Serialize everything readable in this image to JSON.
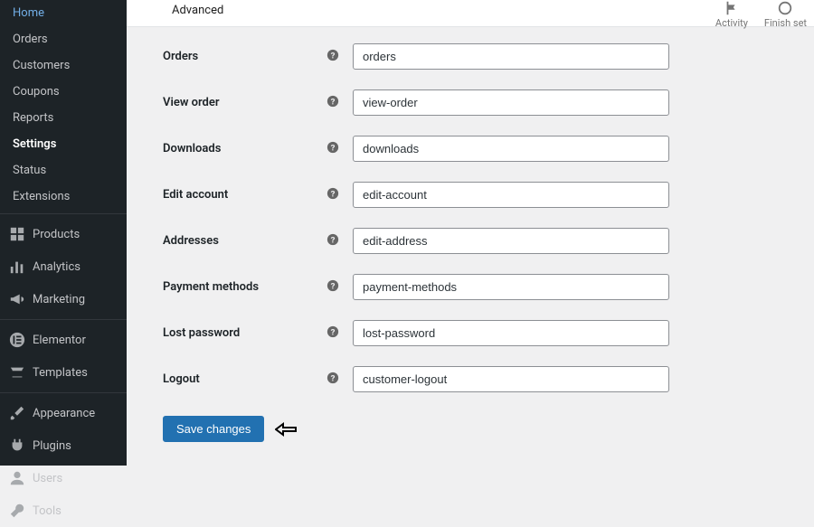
{
  "sidebar": {
    "sub_items": [
      {
        "label": "Home"
      },
      {
        "label": "Orders"
      },
      {
        "label": "Customers"
      },
      {
        "label": "Coupons"
      },
      {
        "label": "Reports"
      },
      {
        "label": "Settings",
        "current": true
      },
      {
        "label": "Status"
      },
      {
        "label": "Extensions"
      }
    ],
    "main_items_1": [
      {
        "label": "Products"
      },
      {
        "label": "Analytics"
      },
      {
        "label": "Marketing"
      }
    ],
    "main_items_2": [
      {
        "label": "Elementor"
      },
      {
        "label": "Templates"
      }
    ],
    "main_items_3": [
      {
        "label": "Appearance"
      },
      {
        "label": "Plugins"
      },
      {
        "label": "Users"
      },
      {
        "label": "Tools"
      }
    ]
  },
  "tabs": {
    "advanced": "Advanced"
  },
  "top": {
    "activity": "Activity",
    "finish": "Finish set"
  },
  "form": {
    "rows": [
      {
        "label": "Orders",
        "value": "orders"
      },
      {
        "label": "View order",
        "value": "view-order"
      },
      {
        "label": "Downloads",
        "value": "downloads"
      },
      {
        "label": "Edit account",
        "value": "edit-account"
      },
      {
        "label": "Addresses",
        "value": "edit-address"
      },
      {
        "label": "Payment methods",
        "value": "payment-methods"
      },
      {
        "label": "Lost password",
        "value": "lost-password"
      },
      {
        "label": "Logout",
        "value": "customer-logout"
      }
    ],
    "save": "Save changes"
  }
}
